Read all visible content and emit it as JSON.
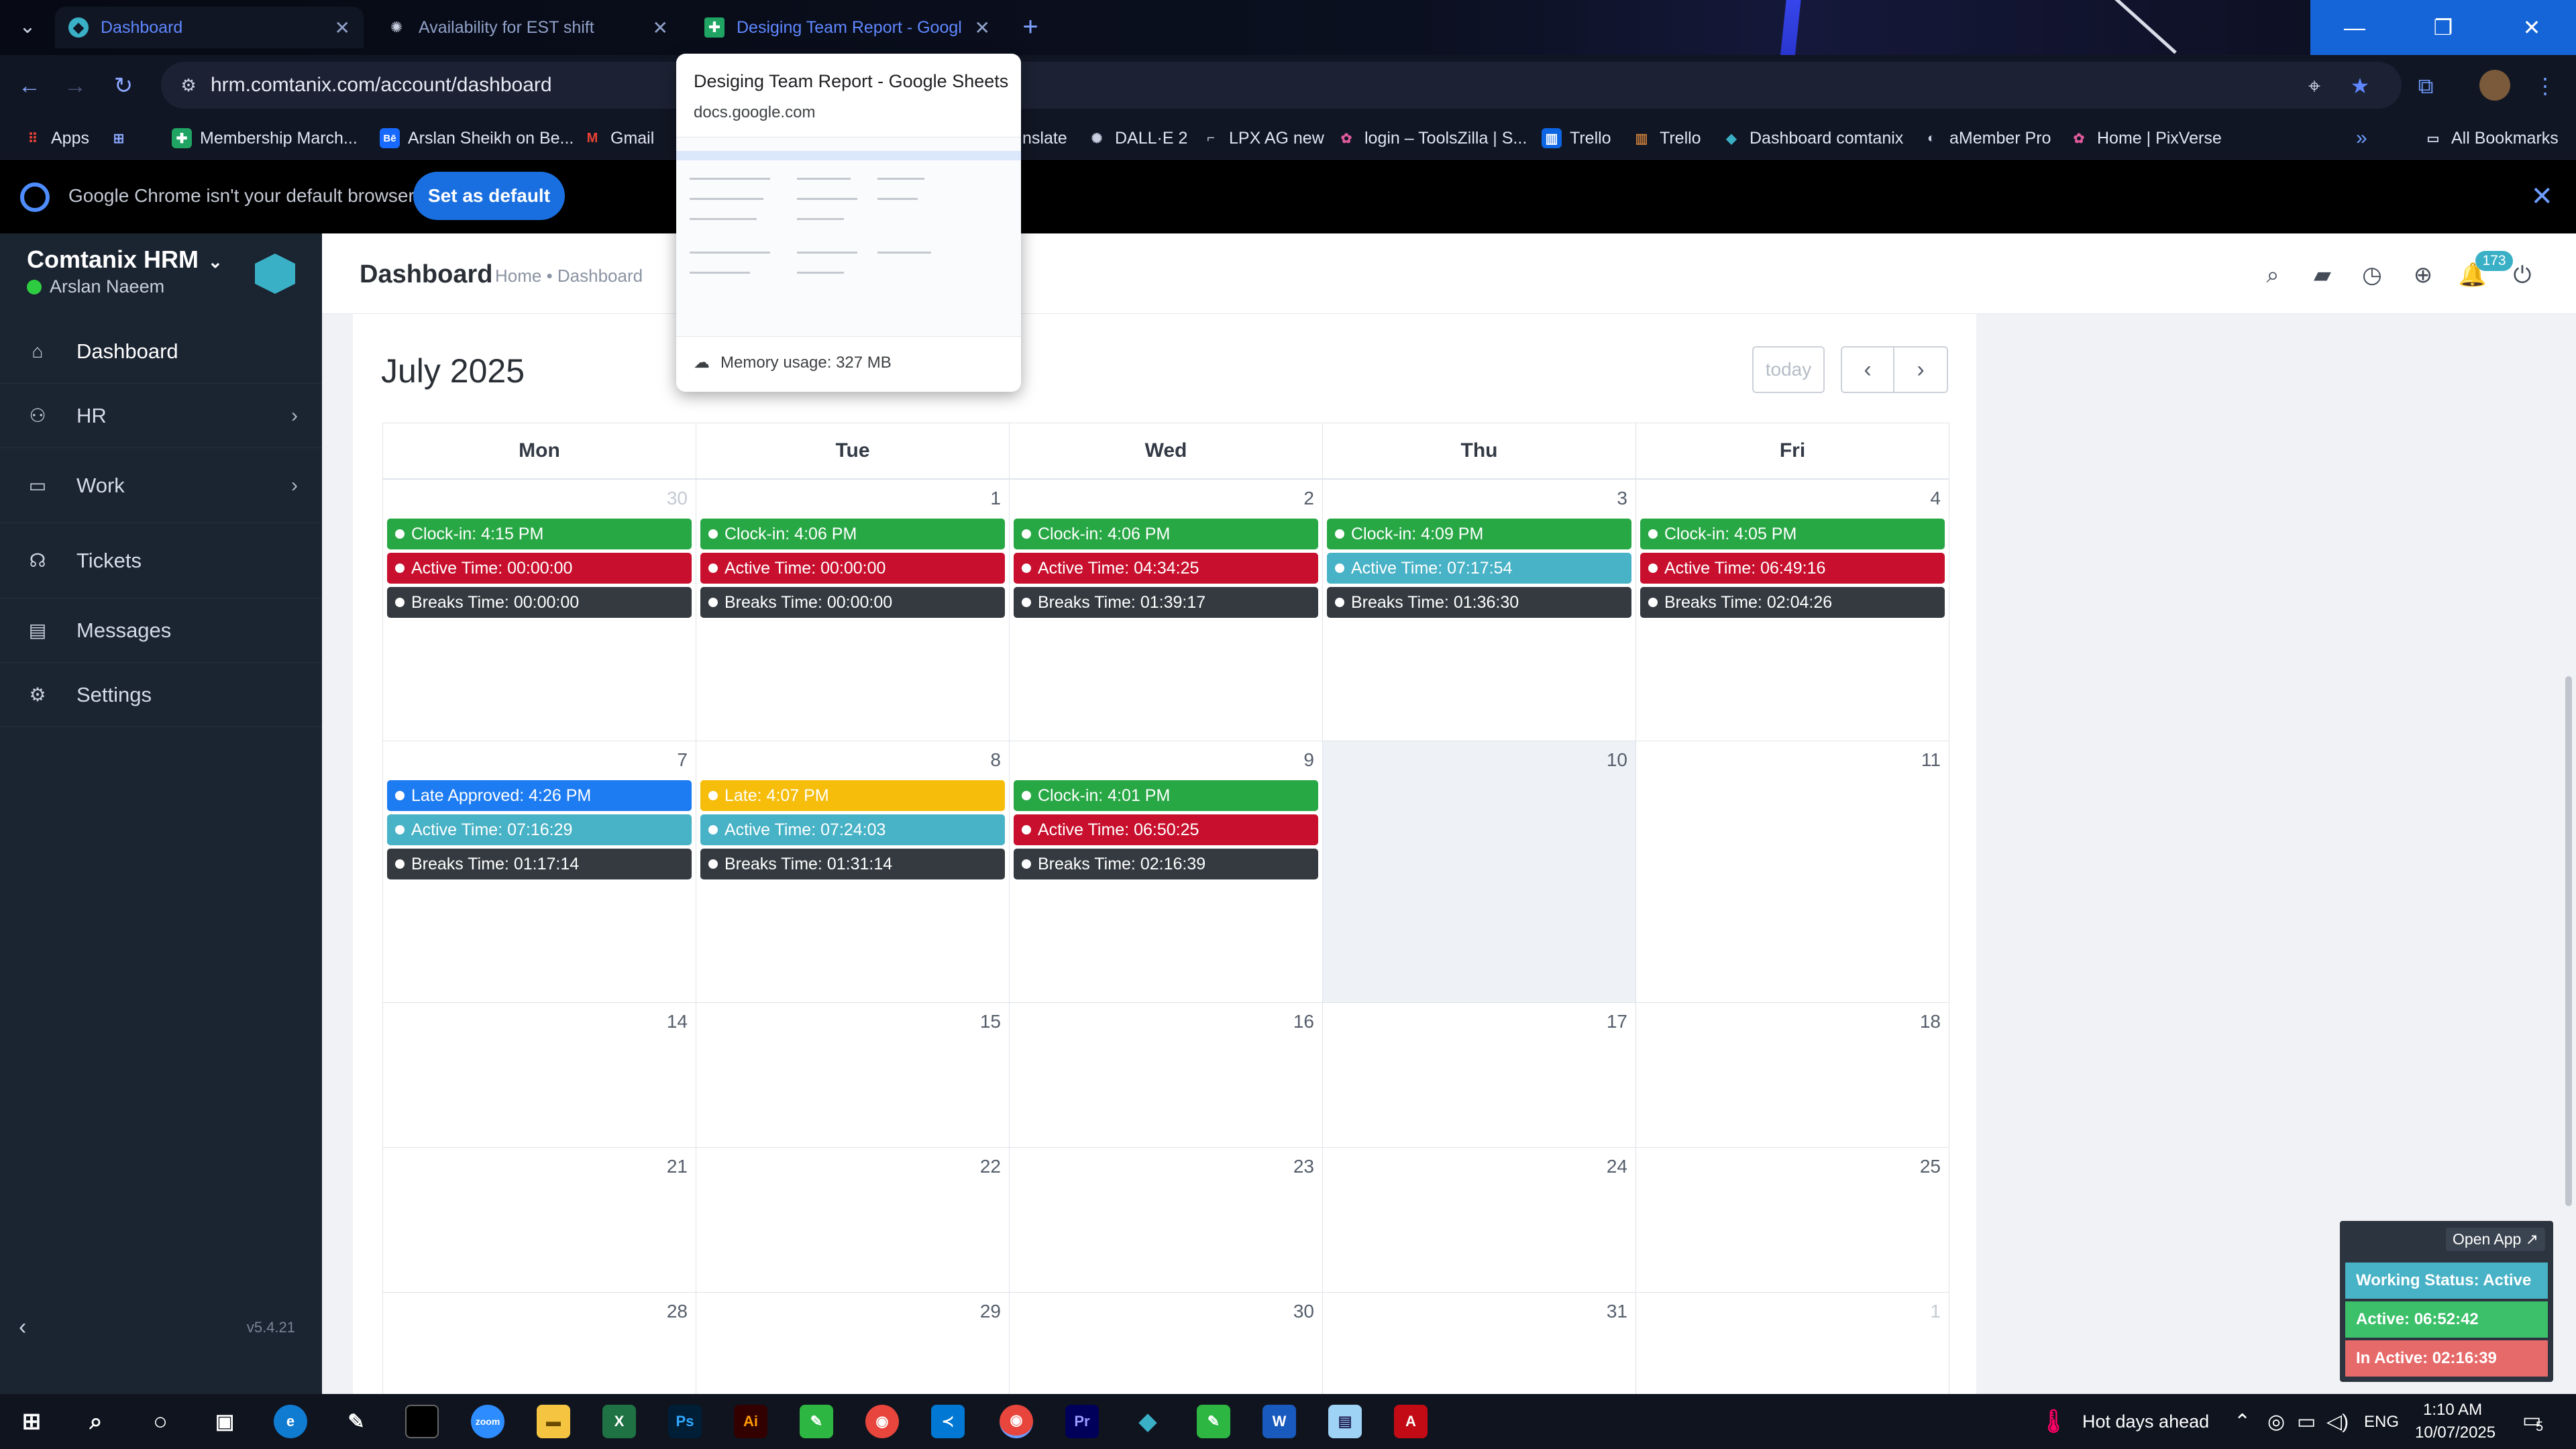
{
  "browser": {
    "tabs": [
      {
        "title": "Dashboard",
        "active": true
      },
      {
        "title": "Availability for EST shift",
        "active": false
      },
      {
        "title": "Desiging Team Report - Google Sheets",
        "active": false
      }
    ],
    "url": "hrm.comtanix.com/account/dashboard",
    "bookmarks": [
      {
        "label": "Apps",
        "icon": "apps-grid-icon"
      },
      {
        "label": "Membership March...",
        "icon": "sheets-icon"
      },
      {
        "label": "Arslan Sheikh on Be...",
        "icon": "behance-icon"
      },
      {
        "label": "Gmail",
        "icon": "gmail-icon"
      },
      {
        "label": "nslate",
        "icon": "translate-icon"
      },
      {
        "label": "DALL·E 2",
        "icon": "openai-icon"
      },
      {
        "label": "LPX AG new",
        "icon": "page-icon"
      },
      {
        "label": "login – ToolsZilla | S...",
        "icon": "toolszilla-icon"
      },
      {
        "label": "Trello",
        "icon": "trello-icon"
      },
      {
        "label": "Trello",
        "icon": "trello-icon"
      },
      {
        "label": "Dashboard comtanix",
        "icon": "comtanix-icon"
      },
      {
        "label": "aMember Pro",
        "icon": "amember-icon"
      },
      {
        "label": "Home | PixVerse",
        "icon": "pixverse-icon"
      }
    ],
    "all_bookmarks": "All Bookmarks",
    "infobar": {
      "message": "Google Chrome isn't your default browser",
      "button": "Set as default"
    },
    "hovercard": {
      "title": "Desiging Team Report - Google Sheets",
      "domain": "docs.google.com",
      "memory": "Memory usage: 327 MB"
    }
  },
  "sidebar": {
    "brand": "Comtanix HRM",
    "user": "Arslan Naeem",
    "items": [
      {
        "label": "Dashboard",
        "icon": "home-icon",
        "arrow": false
      },
      {
        "label": "HR",
        "icon": "users-icon",
        "arrow": true
      },
      {
        "label": "Work",
        "icon": "briefcase-icon",
        "arrow": true
      },
      {
        "label": "Tickets",
        "icon": "headset-icon",
        "arrow": false
      },
      {
        "label": "Messages",
        "icon": "messages-icon",
        "arrow": false
      },
      {
        "label": "Settings",
        "icon": "gear-icon",
        "arrow": false
      }
    ],
    "version": "v5.4.21"
  },
  "header": {
    "title": "Dashboard",
    "breadcrumb": "Home • Dashboard",
    "notification_count": "173"
  },
  "calendar": {
    "month": "July 2025",
    "today_label": "today",
    "weekdays": [
      "Mon",
      "Tue",
      "Wed",
      "Thu",
      "Fri"
    ],
    "weeks": [
      [
        {
          "day": "30",
          "dim": true,
          "events": [
            {
              "type": "clockin",
              "text": "Clock-in: 4:15 PM"
            },
            {
              "type": "red",
              "text": "Active Time: 00:00:00"
            },
            {
              "type": "dark",
              "text": "Breaks Time: 00:00:00"
            }
          ]
        },
        {
          "day": "1",
          "events": [
            {
              "type": "clockin",
              "text": "Clock-in: 4:06 PM"
            },
            {
              "type": "red",
              "text": "Active Time: 00:00:00"
            },
            {
              "type": "dark",
              "text": "Breaks Time: 00:00:00"
            }
          ]
        },
        {
          "day": "2",
          "events": [
            {
              "type": "clockin",
              "text": "Clock-in: 4:06 PM"
            },
            {
              "type": "red",
              "text": "Active Time: 04:34:25"
            },
            {
              "type": "dark",
              "text": "Breaks Time: 01:39:17"
            }
          ]
        },
        {
          "day": "3",
          "events": [
            {
              "type": "clockin",
              "text": "Clock-in: 4:09 PM"
            },
            {
              "type": "teal",
              "text": "Active Time: 07:17:54"
            },
            {
              "type": "dark",
              "text": "Breaks Time: 01:36:30"
            }
          ]
        },
        {
          "day": "4",
          "events": [
            {
              "type": "clockin",
              "text": "Clock-in: 4:05 PM"
            },
            {
              "type": "red",
              "text": "Active Time: 06:49:16"
            },
            {
              "type": "dark",
              "text": "Breaks Time: 02:04:26"
            }
          ]
        }
      ],
      [
        {
          "day": "7",
          "events": [
            {
              "type": "blue",
              "text": "Late Approved: 4:26 PM"
            },
            {
              "type": "teal",
              "text": "Active Time: 07:16:29"
            },
            {
              "type": "dark",
              "text": "Breaks Time: 01:17:14"
            }
          ]
        },
        {
          "day": "8",
          "events": [
            {
              "type": "amber",
              "text": "Late: 4:07 PM"
            },
            {
              "type": "teal",
              "text": "Active Time: 07:24:03"
            },
            {
              "type": "dark",
              "text": "Breaks Time: 01:31:14"
            }
          ]
        },
        {
          "day": "9",
          "events": [
            {
              "type": "clockin",
              "text": "Clock-in: 4:01 PM"
            },
            {
              "type": "red",
              "text": "Active Time: 06:50:25"
            },
            {
              "type": "dark",
              "text": "Breaks Time: 02:16:39"
            }
          ]
        },
        {
          "day": "10",
          "today": true,
          "events": []
        },
        {
          "day": "11",
          "events": []
        }
      ],
      [
        {
          "day": "14",
          "events": []
        },
        {
          "day": "15",
          "events": []
        },
        {
          "day": "16",
          "events": []
        },
        {
          "day": "17",
          "events": []
        },
        {
          "day": "18",
          "events": []
        }
      ],
      [
        {
          "day": "21",
          "events": []
        },
        {
          "day": "22",
          "events": []
        },
        {
          "day": "23",
          "events": []
        },
        {
          "day": "24",
          "events": []
        },
        {
          "day": "25",
          "events": []
        }
      ],
      [
        {
          "day": "28",
          "events": []
        },
        {
          "day": "29",
          "events": []
        },
        {
          "day": "30",
          "events": []
        },
        {
          "day": "31",
          "events": []
        },
        {
          "day": "1",
          "dim": true,
          "events": []
        }
      ]
    ]
  },
  "widget": {
    "open_app": "Open App ↗",
    "working_status": "Working Status: Active",
    "active": "Active: 06:52:42",
    "inactive": "In Active: 02:16:39"
  },
  "taskbar": {
    "weather": "Hot days ahead",
    "language": "ENG",
    "time": "1:10 AM",
    "date": "10/07/2025",
    "notifications": "5"
  },
  "colors": {
    "sidebar_bg": "#1b2431",
    "accent": "#3ab0c6",
    "clockin": "#28a745",
    "active_red": "#c8102e",
    "active_teal": "#48b2c6",
    "breaks": "#343a40",
    "late_approved": "#1e7cf2",
    "late": "#f6bd0b"
  }
}
